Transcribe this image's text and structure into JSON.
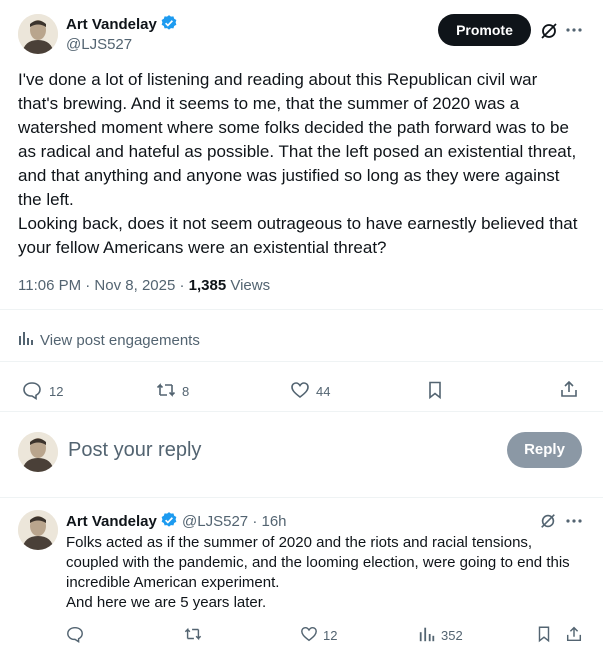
{
  "post": {
    "author_name": "Art Vandelay",
    "author_handle": "@LJS527",
    "promote_label": "Promote",
    "text": "I've done a lot of listening and reading about this Republican civil war that's brewing. And it seems to me, that the summer of 2020 was a watershed moment where some folks decided the path forward was to be as radical and hateful as possible. That the left posed an existential threat, and that anything and anyone was justified so long as they were against the left.\nLooking back, does it not seem outrageous to have earnestly believed that your fellow Americans were an existential threat?",
    "time": "11:06 PM · Nov 8, 2025 · ",
    "views_count": "1,385",
    "views_label": "Views",
    "engagements_label": "View post engagements",
    "replies": "12",
    "reposts": "8",
    "likes": "44"
  },
  "compose": {
    "placeholder": "Post your reply",
    "reply_label": "Reply"
  },
  "reply": {
    "author_name": "Art Vandelay",
    "author_handle": "@LJS527",
    "time": "· 16h",
    "text": "Folks acted as if the summer of 2020 and the riots and racial tensions, coupled with the pandemic, and the looming election, were going to end this incredible American experiment.\nAnd here we are 5 years later.",
    "likes": "12",
    "views": "352"
  },
  "colors": {
    "verified_blue": "#1d9bf0",
    "secondary_text": "#536471",
    "promote_bg": "#0f1419",
    "reply_btn_bg": "#8b98a5"
  }
}
